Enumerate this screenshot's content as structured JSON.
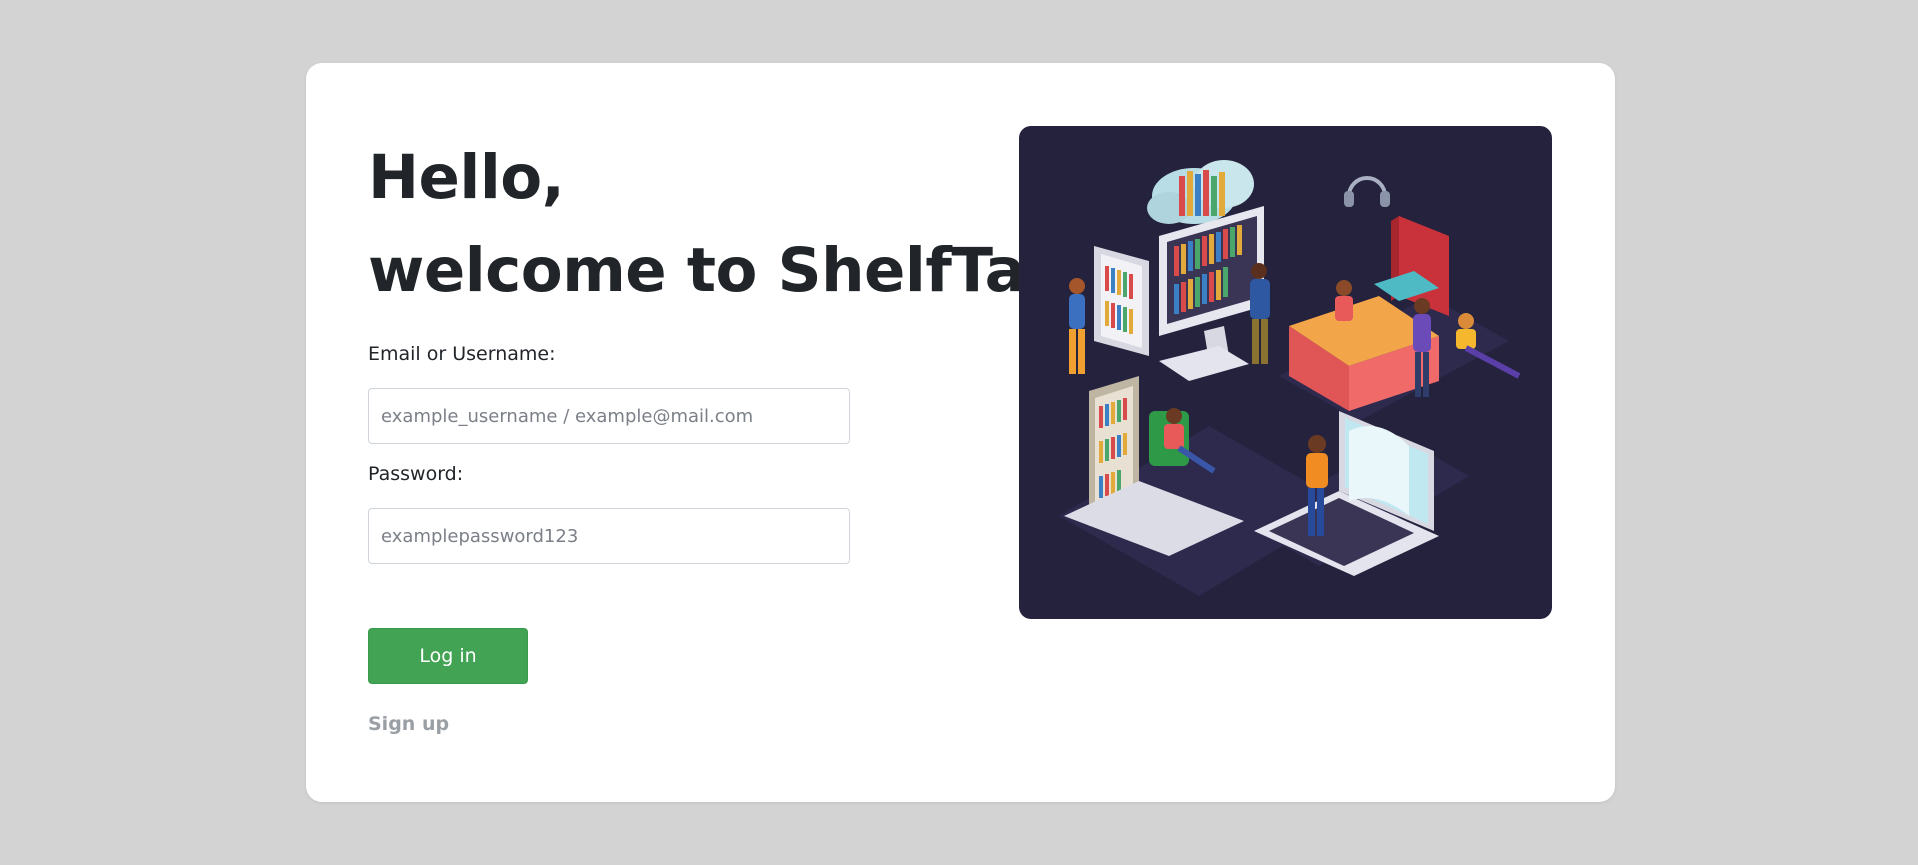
{
  "heading": {
    "line1": "Hello,",
    "line2": "welcome to ShelfTalk!"
  },
  "form": {
    "email_label": "Email or Username:",
    "email_placeholder": "example_username / example@mail.com",
    "password_label": "Password:",
    "password_placeholder": "examplepassword123",
    "login_label": "Log in",
    "signup_label": "Sign up"
  },
  "colors": {
    "background": "#d3d3d3",
    "card": "#ffffff",
    "primary_button": "#43a354",
    "illustration_bg": "#24223d",
    "signup_link": "#9a9fa5"
  },
  "illustration": {
    "icon": "library-illustration"
  }
}
